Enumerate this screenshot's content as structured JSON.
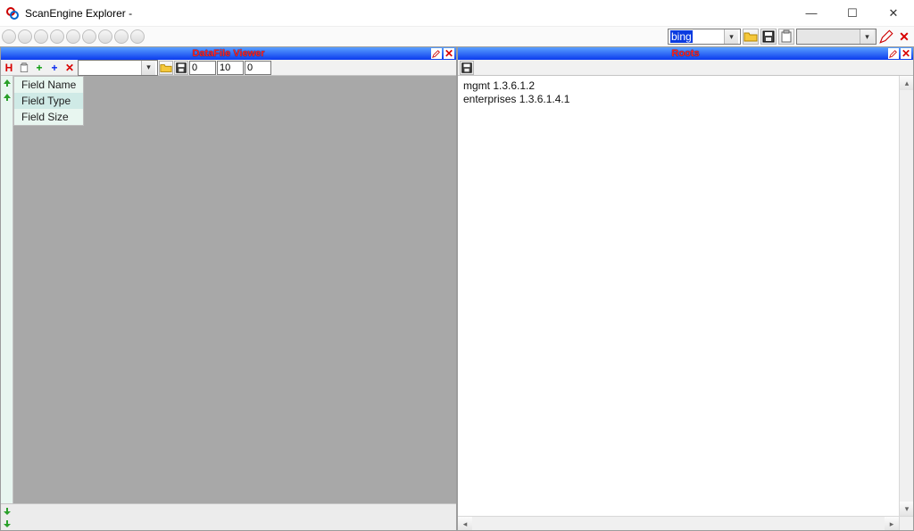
{
  "window": {
    "title": "ScanEngine Explorer -"
  },
  "top_controls": {
    "search_value": "bing",
    "combo2_value": ""
  },
  "panels": {
    "left": {
      "title": "DataFile Viewer",
      "toolbar": {
        "h_label": "H",
        "plus_green": "+",
        "plus_blue": "+",
        "x_red": "✕",
        "combo_value": "",
        "num1": "0",
        "num2": "10",
        "num3": "0"
      },
      "fields": [
        "Field Name",
        "Field Type",
        "Field Size"
      ]
    },
    "right": {
      "title": "Roots",
      "items": [
        "mgmt 1.3.6.1.2",
        "enterprises 1.3.6.1.4.1"
      ]
    }
  }
}
